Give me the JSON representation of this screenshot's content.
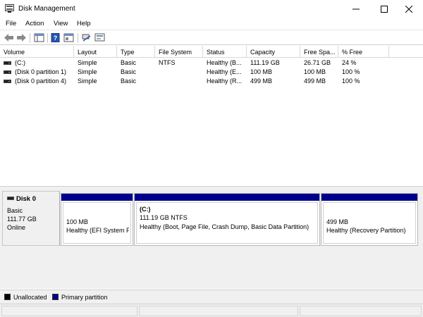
{
  "window": {
    "title": "Disk Management"
  },
  "menu": [
    "File",
    "Action",
    "View",
    "Help"
  ],
  "toolbar": {
    "icons": [
      "back-arrow-icon",
      "forward-arrow-icon",
      "show-pane-icon",
      "help-icon",
      "properties-icon",
      "connect-icon",
      "console-icon"
    ]
  },
  "columns": [
    "Volume",
    "Layout",
    "Type",
    "File System",
    "Status",
    "Capacity",
    "Free Spa...",
    "% Free"
  ],
  "volumes": [
    {
      "volume": "(C:)",
      "layout": "Simple",
      "type": "Basic",
      "fs": "NTFS",
      "status": "Healthy (B...",
      "capacity": "111.19 GB",
      "free": "26.71 GB",
      "pct": "24 %"
    },
    {
      "volume": "(Disk 0 partition 1)",
      "layout": "Simple",
      "type": "Basic",
      "fs": "",
      "status": "Healthy (E...",
      "capacity": "100 MB",
      "free": "100 MB",
      "pct": "100 %"
    },
    {
      "volume": "(Disk 0 partition 4)",
      "layout": "Simple",
      "type": "Basic",
      "fs": "",
      "status": "Healthy (R...",
      "capacity": "499 MB",
      "free": "499 MB",
      "pct": "100 %"
    }
  ],
  "disk": {
    "name": "Disk 0",
    "type": "Basic",
    "size": "111.77 GB",
    "state": "Online",
    "partitions": [
      {
        "label": "",
        "size": "100 MB",
        "status": "Healthy (EFI System P"
      },
      {
        "label": "(C:)",
        "size": "111.19 GB NTFS",
        "status": "Healthy (Boot, Page File, Crash Dump, Basic Data Partition)"
      },
      {
        "label": "",
        "size": "499 MB",
        "status": "Healthy (Recovery Partition)"
      }
    ]
  },
  "legend": [
    {
      "label": "Unallocated",
      "color": "#000000"
    },
    {
      "label": "Primary partition",
      "color": "#00008b"
    }
  ]
}
